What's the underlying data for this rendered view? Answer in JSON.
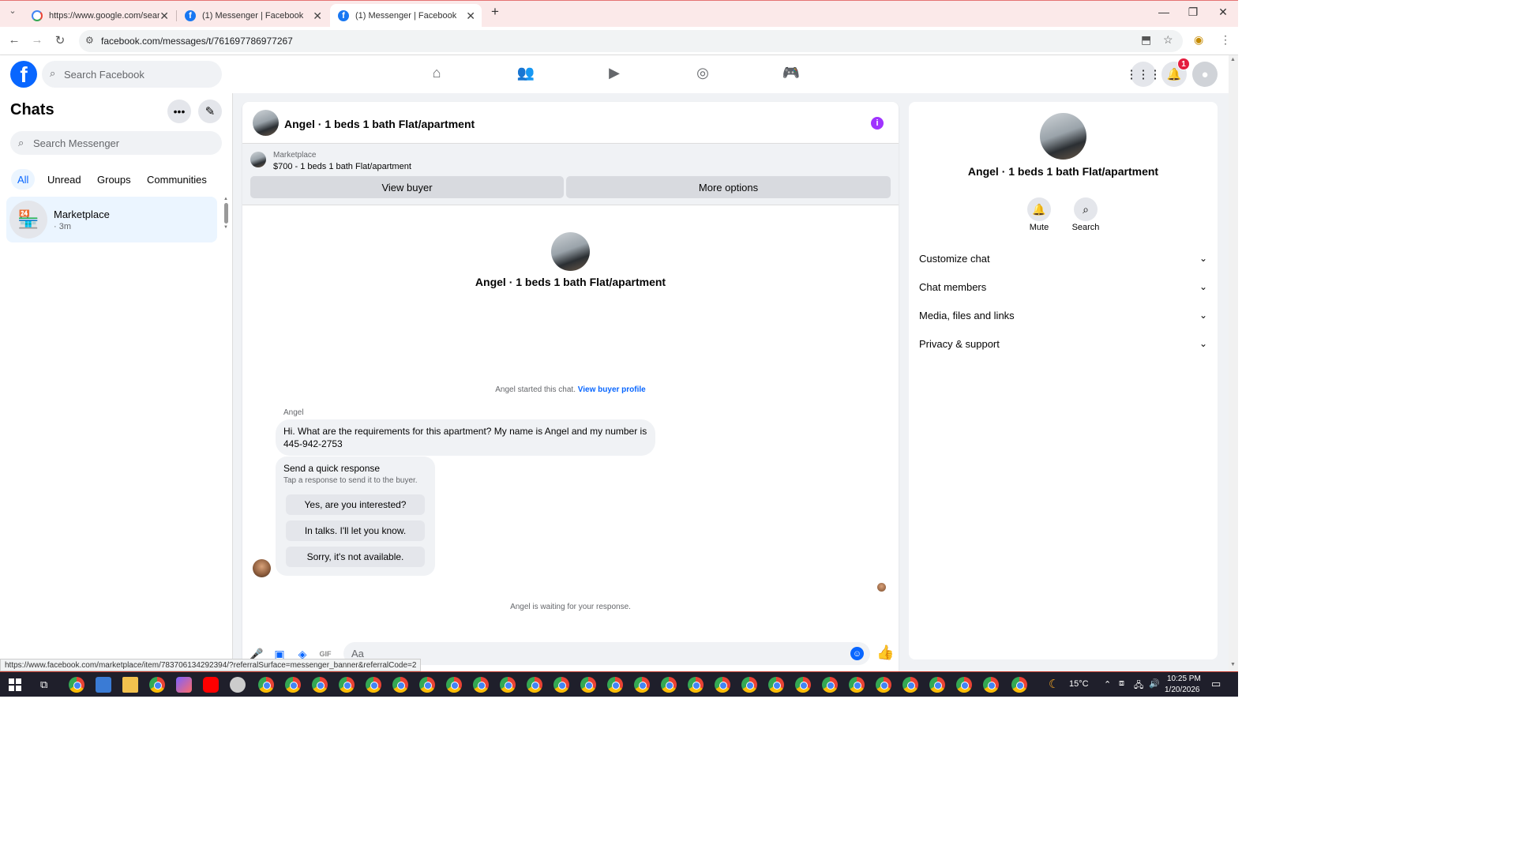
{
  "browser": {
    "tabs": [
      {
        "title": "https://www.google.com/search",
        "favicon": "google-icon"
      },
      {
        "title": "(1) Messenger | Facebook",
        "favicon": "facebook-icon"
      },
      {
        "title": "(1) Messenger | Facebook",
        "favicon": "facebook-icon"
      }
    ],
    "url": "facebook.com/messages/t/761697786977267",
    "status_url": "https://www.facebook.com/marketplace/item/783706134292394/?referralSurface=messenger_banner&referralCode=2"
  },
  "facebook": {
    "search_placeholder": "Search Facebook",
    "notification_count": "1"
  },
  "chats": {
    "title": "Chats",
    "search_placeholder": "Search Messenger",
    "filters": [
      "All",
      "Unread",
      "Groups",
      "Communities"
    ],
    "active_filter": "All",
    "items": [
      {
        "name": "Marketplace",
        "time": "· 3m"
      }
    ]
  },
  "conversation": {
    "title": "Angel · 1 beds 1 bath Flat/apartment",
    "marketplace_label": "Marketplace",
    "listing": "$700 - 1 beds 1 bath Flat/apartment",
    "view_buyer_label": "View buyer",
    "more_options_label": "More options",
    "hero_name": "Angel · 1 beds 1 bath Flat/apartment",
    "started_text": "Angel started this chat.",
    "view_buyer_profile_label": "View buyer profile",
    "sender": "Angel",
    "message": "Hi. What are the requirements for this apartment? My name is Angel and my number is 445-942-2753",
    "quick_response_title": "Send a quick response",
    "quick_response_subtitle": "Tap a response to send it to the buyer.",
    "quick_responses": [
      "Yes, are you interested?",
      "In talks. I'll let you know.",
      "Sorry, it's not available."
    ],
    "waiting_text": "Angel is waiting for your response.",
    "composer_placeholder": "Aa"
  },
  "info_panel": {
    "name": "Angel · 1 beds 1 bath Flat/apartment",
    "mute_label": "Mute",
    "search_label": "Search",
    "sections": [
      "Customize chat",
      "Chat members",
      "Media, files and links",
      "Privacy & support"
    ]
  },
  "taskbar": {
    "temperature": "15°C",
    "time": "10:25 PM",
    "date": "1/20/2026"
  },
  "colors": {
    "facebook_blue": "#0866ff",
    "info_purple": "#a033ff",
    "badge_red": "#e41e3f",
    "selected_bg": "#ebf5ff"
  }
}
